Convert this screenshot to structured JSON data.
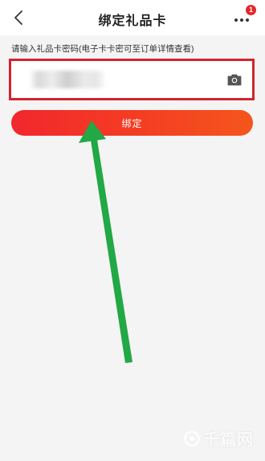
{
  "navbar": {
    "title": "绑定礼品卡",
    "back_icon": "chevron-left-icon",
    "more_icon": "more-dots-icon",
    "badge_count": "1",
    "badge_color": "#e4262a"
  },
  "form": {
    "hint": "请输入礼品卡密码(电子卡卡密可至订单详情查看)",
    "input_value": "",
    "input_placeholder": "",
    "camera_icon": "camera-icon",
    "highlight_color": "#d4232e"
  },
  "actions": {
    "bind_label": "绑定",
    "bind_color": "#f2272d"
  },
  "annotation": {
    "arrow_color": "#22a845"
  },
  "watermark": {
    "text": "千篇网"
  }
}
